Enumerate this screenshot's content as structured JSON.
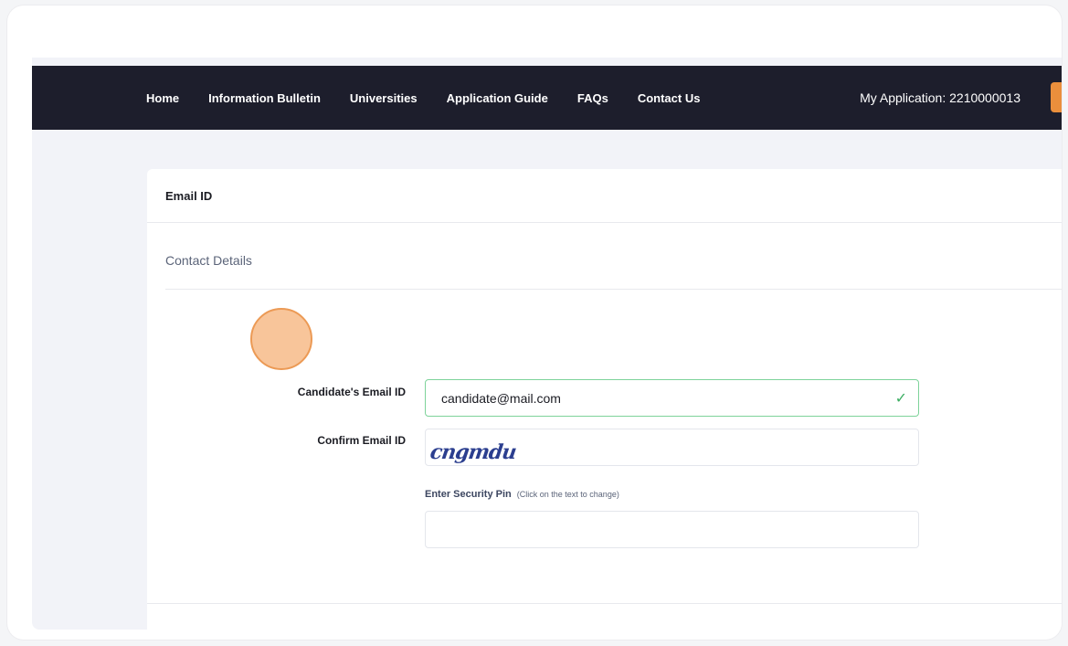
{
  "nav": {
    "links": [
      "Home",
      "Information Bulletin",
      "Universities",
      "Application Guide",
      "FAQs",
      "Contact Us"
    ],
    "application_label": "My Application: 2210000013"
  },
  "card": {
    "title": "Email ID",
    "section": "Contact Details"
  },
  "form": {
    "email_label": "Candidate's Email ID",
    "email_value": "candidate@mail.com",
    "confirm_label": "Confirm Email ID",
    "confirm_value": "",
    "captcha_text": "cngmdu",
    "pin_label": "Enter Security Pin",
    "pin_hint": "(Click on the text to change)",
    "pin_value": ""
  },
  "icons": {
    "valid_check": "check-icon"
  },
  "colors": {
    "navbar": "#1d1e2c",
    "accent_orange": "#ea8f3c",
    "valid_green": "#7ed39a",
    "captcha_blue": "#2b3e8f"
  }
}
